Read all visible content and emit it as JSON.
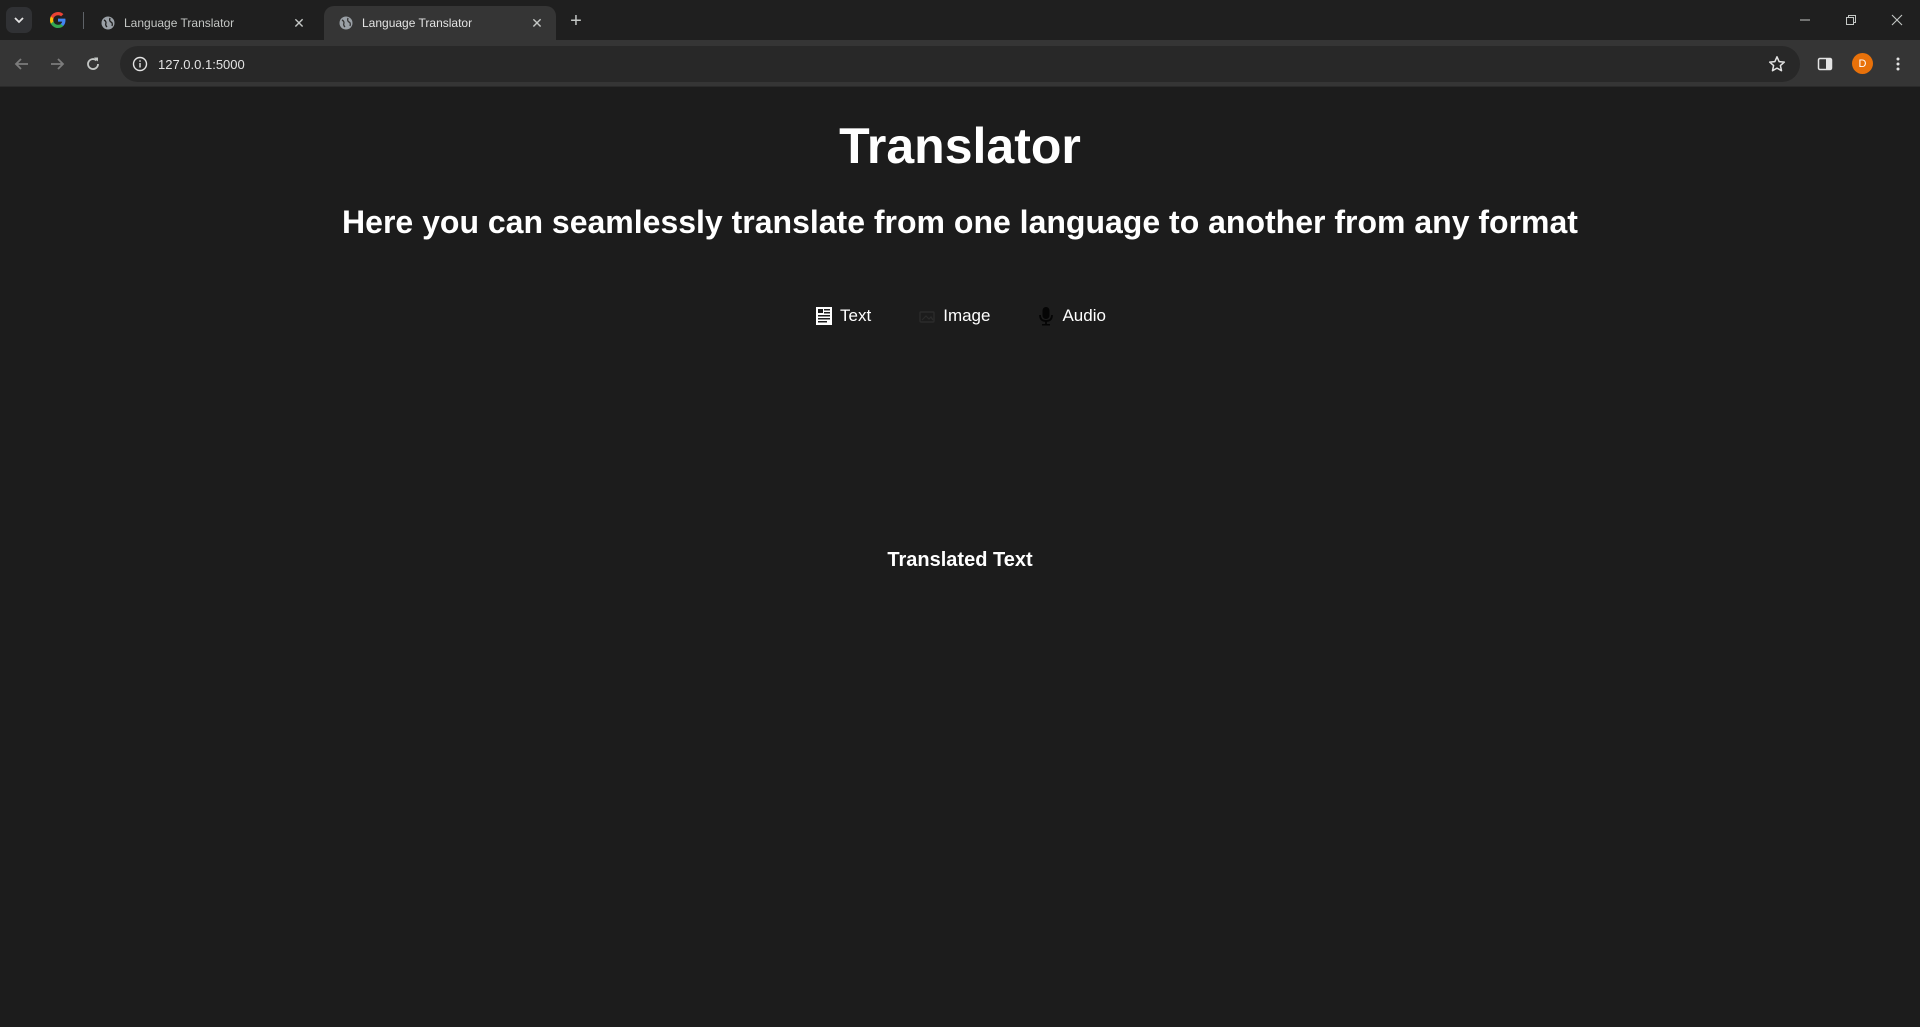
{
  "browser": {
    "tabs": [
      {
        "title": "Language Translator",
        "active": false
      },
      {
        "title": "Language Translator",
        "active": true
      }
    ],
    "address": {
      "url": "127.0.0.1:5000"
    },
    "profile_initial": "D",
    "profile_color": "#e8710a"
  },
  "page": {
    "title": "Translator",
    "subtitle": "Here you can seamlessly translate from one language to another from any format",
    "modes": [
      {
        "label": "Text",
        "icon": "text-document-icon"
      },
      {
        "label": "Image",
        "icon": "image-icon"
      },
      {
        "label": "Audio",
        "icon": "microphone-icon"
      }
    ],
    "output_heading": "Translated Text"
  },
  "colors": {
    "page_background": "#1c1c1c",
    "text": "#ffffff"
  }
}
